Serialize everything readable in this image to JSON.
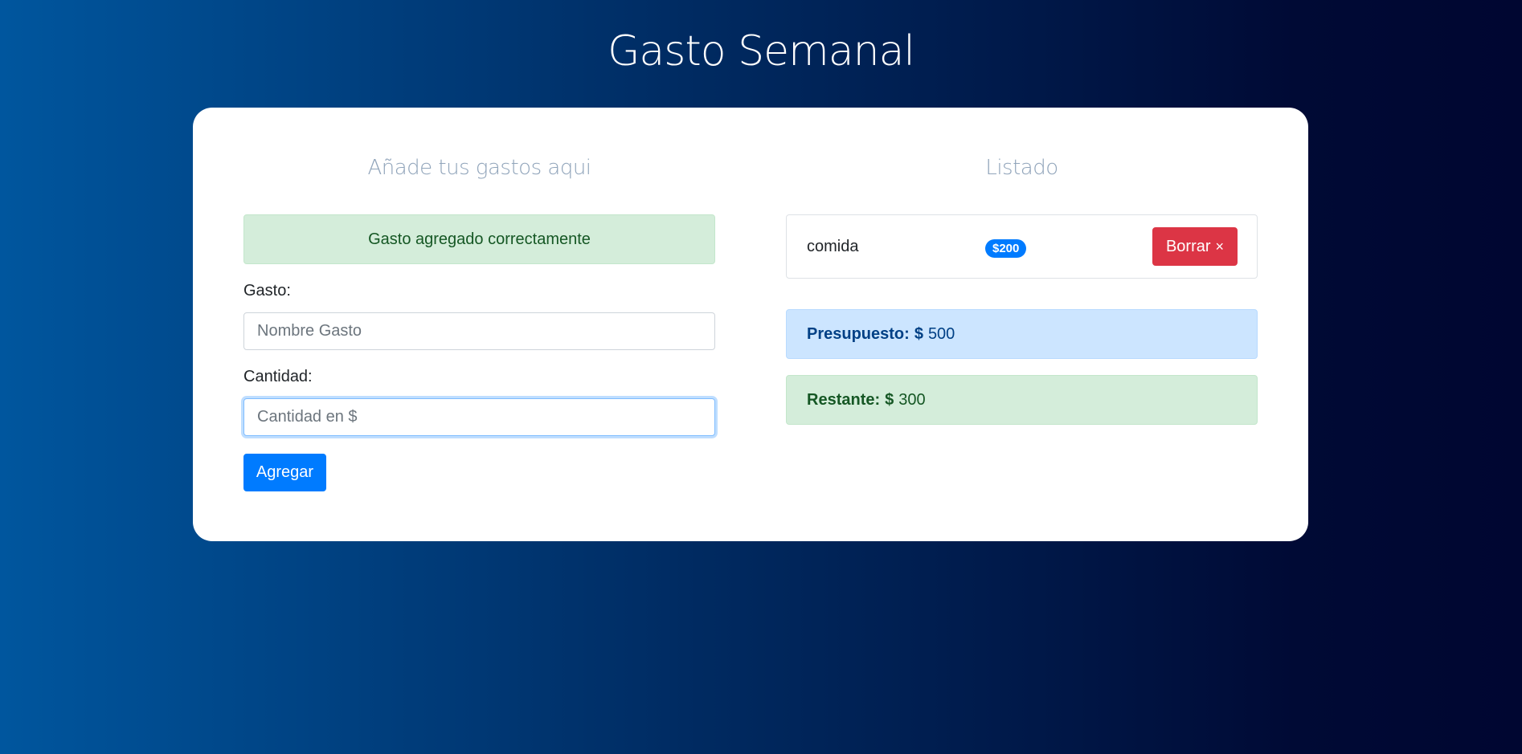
{
  "page_title": "Gasto Semanal",
  "form": {
    "title": "Añade tus gastos aqui",
    "success_message": "Gasto agregado correctamente",
    "gasto_label": "Gasto:",
    "gasto_placeholder": "Nombre Gasto",
    "cantidad_label": "Cantidad:",
    "cantidad_placeholder": "Cantidad en $",
    "submit_label": "Agregar"
  },
  "listado": {
    "title": "Listado",
    "items": [
      {
        "name": "comida",
        "amount": "$200",
        "delete_label": "Borrar",
        "delete_icon": "×"
      }
    ]
  },
  "budget": {
    "presupuesto_label": "Presupuesto:",
    "presupuesto_currency": "$",
    "presupuesto_value": "500",
    "restante_label": "Restante:",
    "restante_currency": "$",
    "restante_value": "300"
  },
  "colors": {
    "primary": "#007bff",
    "danger": "#dc3545",
    "success_bg": "#d4edda",
    "info_bg": "#cce5ff"
  }
}
